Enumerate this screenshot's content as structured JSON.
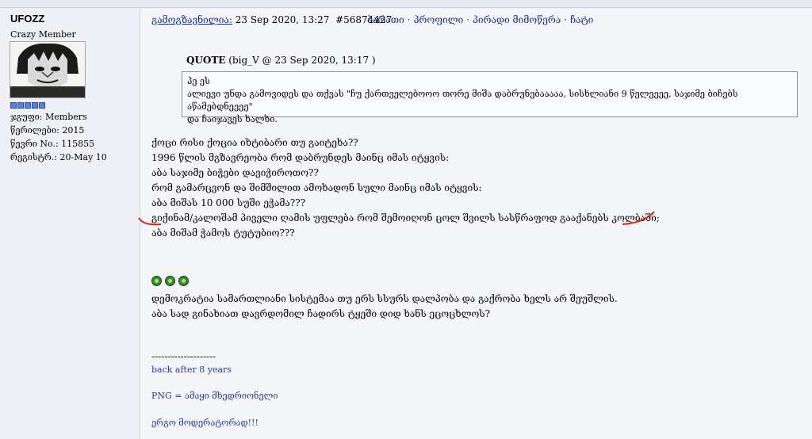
{
  "user": {
    "name": "UFOZZ",
    "title": "Crazy Member",
    "group": "ჯგუფი: Members",
    "posts": "წერილები: 2015",
    "member_no": "წევრი No.: 115855",
    "registered": "რეგისტრ.: 20-May 10"
  },
  "post": {
    "posted_label": "გამოგზავნილია:",
    "date": "23 Sep 2020, 13:27",
    "post_id": "#56874427",
    "links": [
      "ბარათი",
      "პროფილი",
      "პირადი მიმოწერა",
      "ჩატი"
    ],
    "quote_header_bold": "QUOTE",
    "quote_header_rest": "(big_V @ 23 Sep 2020, 13:17 )",
    "quote_lines": [
      "პე ეს",
      "ალიევი უნდა გამოვიდეს და თქვას \"ჩუ ქართველებოოო თორე მიშა დაბრუნებააააა, სისხლიანი 9 წელეეეე, საჯიმე ბიჩებს აწამებდნეეეე\"",
      "და ჩაიჯავეს ხალხი."
    ],
    "body_lines": [
      "ქოცი რისი ქოცია იხტიბარი თუ გაიტეხა??",
      "1996 წლის მგზავრეობა რომ დაბრუნდეს მაინც იმას იტყვის:",
      "აბა საჯიმე ბიჭები დავიჭიროთო??",
      "რომ გამარცვონ და შიმშილით ამოხადონ სული მაინც იმას იტყვის:",
      "აბა მიშას 10 000 სუში ეჭამა???",
      "გიქინამ/კალოშამ პიველი ღამის უფლება რომ შემოიღონ ცოლ შვილს სასწრაფოდ გააქანებს კოლბაში;",
      "აბა მიშამ ჭამოს ტუტუბიო???"
    ],
    "para2": [
      "დემოკრატია სამართლიანი სისტემაა თუ ერს სსურს დალპობა და გაქრობა ხელს არ შეუშლის.",
      "აბა სად გინახიათ დავრდომილ ჩადირს ტყეში დიდ ხანს ეცოცხლოს?"
    ],
    "signature": {
      "rule": "--------------------",
      "line1": "back after 8 years",
      "line2": "PNG = ამაყი მხედრიონელი",
      "line3": "ერგო მოდერატორად!!!"
    }
  },
  "colors": {
    "link": "#1c2a8f",
    "signature": "#2a3a9a",
    "annotation": "#e02020",
    "rank_pip": "#5b7fd6"
  }
}
